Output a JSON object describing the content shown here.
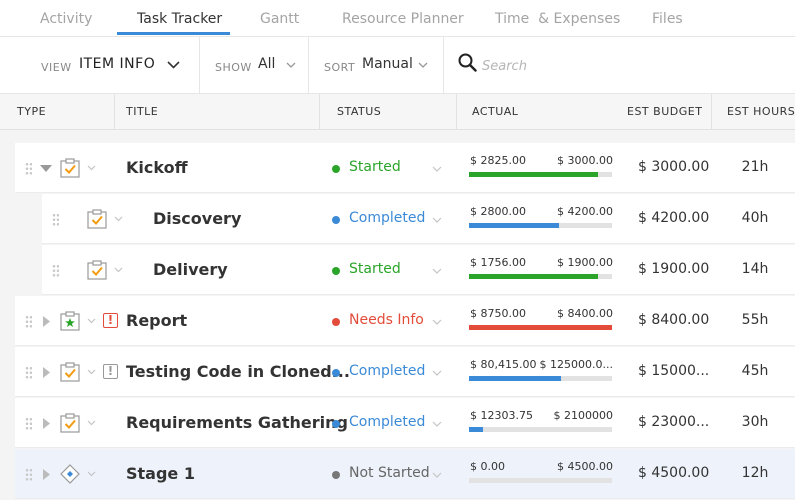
{
  "tabs": [
    {
      "label": "Activity",
      "active": false
    },
    {
      "label": "Task Tracker",
      "active": true
    },
    {
      "label": "Gantt",
      "active": false
    },
    {
      "label": "Resource Planner",
      "active": false
    },
    {
      "label": "Time  & Expenses",
      "active": false
    },
    {
      "label": "Files",
      "active": false
    }
  ],
  "toolbar": {
    "view_label": "VIEW",
    "view_value": "ITEM INFO",
    "show_label": "SHOW",
    "show_value": "All",
    "sort_label": "SORT",
    "sort_value": "Manual",
    "search_placeholder": "Search"
  },
  "columns": [
    "TYPE",
    "TITLE",
    "STATUS",
    "ACTUAL",
    "EST BUDGET",
    "EST HOURS"
  ],
  "colors": {
    "accent": "#3b8ad7",
    "green": "#2aa52a",
    "blue": "#3b8ad7",
    "red": "#e34c3b",
    "gray": "#777777",
    "orange": "#f39c12"
  },
  "rows": [
    {
      "title": "Kickoff",
      "level": 0,
      "expanded": true,
      "type_icon": "task-icon",
      "alert": false,
      "status": "Started",
      "status_color": "#2aa52a",
      "actual": "$ 2825.00",
      "budget_compare": "$ 3000.00",
      "progress": 0.9,
      "bar_color": "#2aa52a",
      "est_budget": "$ 3000.00",
      "est_hours": "21h",
      "highlight": false
    },
    {
      "title": "Discovery",
      "level": 1,
      "expanded": null,
      "type_icon": "task-icon",
      "alert": false,
      "status": "Completed",
      "status_color": "#3b8ad7",
      "actual": "$ 2800.00",
      "budget_compare": "$ 4200.00",
      "progress": 0.63,
      "bar_color": "#3b8ad7",
      "est_budget": "$ 4200.00",
      "est_hours": "40h",
      "highlight": false
    },
    {
      "title": "Delivery",
      "level": 1,
      "expanded": null,
      "type_icon": "task-icon",
      "alert": false,
      "status": "Started",
      "status_color": "#2aa52a",
      "actual": "$ 1756.00",
      "budget_compare": "$ 1900.00",
      "progress": 0.9,
      "bar_color": "#2aa52a",
      "est_budget": "$ 1900.00",
      "est_hours": "14h",
      "highlight": false
    },
    {
      "title": "Report",
      "level": 0,
      "expanded": false,
      "type_icon": "milestone-star-icon",
      "alert": true,
      "alert_color": "#e34c3b",
      "status": "Needs Info",
      "status_color": "#e34c3b",
      "actual": "$ 8750.00",
      "budget_compare": "$ 8400.00",
      "progress": 1.0,
      "bar_color": "#e34c3b",
      "est_budget": "$ 8400.00",
      "est_hours": "55h",
      "highlight": false
    },
    {
      "title": "Testing Code in Cloned...",
      "level": 0,
      "expanded": false,
      "type_icon": "task-icon",
      "alert": true,
      "alert_color": "#999999",
      "status": "Completed",
      "status_color": "#3b8ad7",
      "actual": "$ 80,415.00",
      "budget_compare": "$ 125000.0...",
      "progress": 0.64,
      "bar_color": "#3b8ad7",
      "est_budget": "$ 15000...",
      "est_hours": "45h",
      "highlight": false
    },
    {
      "title": "Requirements Gathering",
      "level": 0,
      "expanded": false,
      "type_icon": "task-icon",
      "alert": false,
      "status": "Completed",
      "status_color": "#3b8ad7",
      "actual": "$ 12303.75",
      "budget_compare": "$ 2100000",
      "progress": 0.1,
      "bar_color": "#3b8ad7",
      "est_budget": "$ 23000...",
      "est_hours": "30h",
      "highlight": false
    },
    {
      "title": "Stage 1",
      "level": 0,
      "expanded": false,
      "type_icon": "stage-diamond-icon",
      "alert": false,
      "status": "Not Started",
      "status_color": "#777777",
      "actual": "$ 0.00",
      "budget_compare": "$ 4500.00",
      "progress": 0.0,
      "bar_color": "#3b8ad7",
      "est_budget": "$ 4500.00",
      "est_hours": "12h",
      "highlight": true
    }
  ]
}
